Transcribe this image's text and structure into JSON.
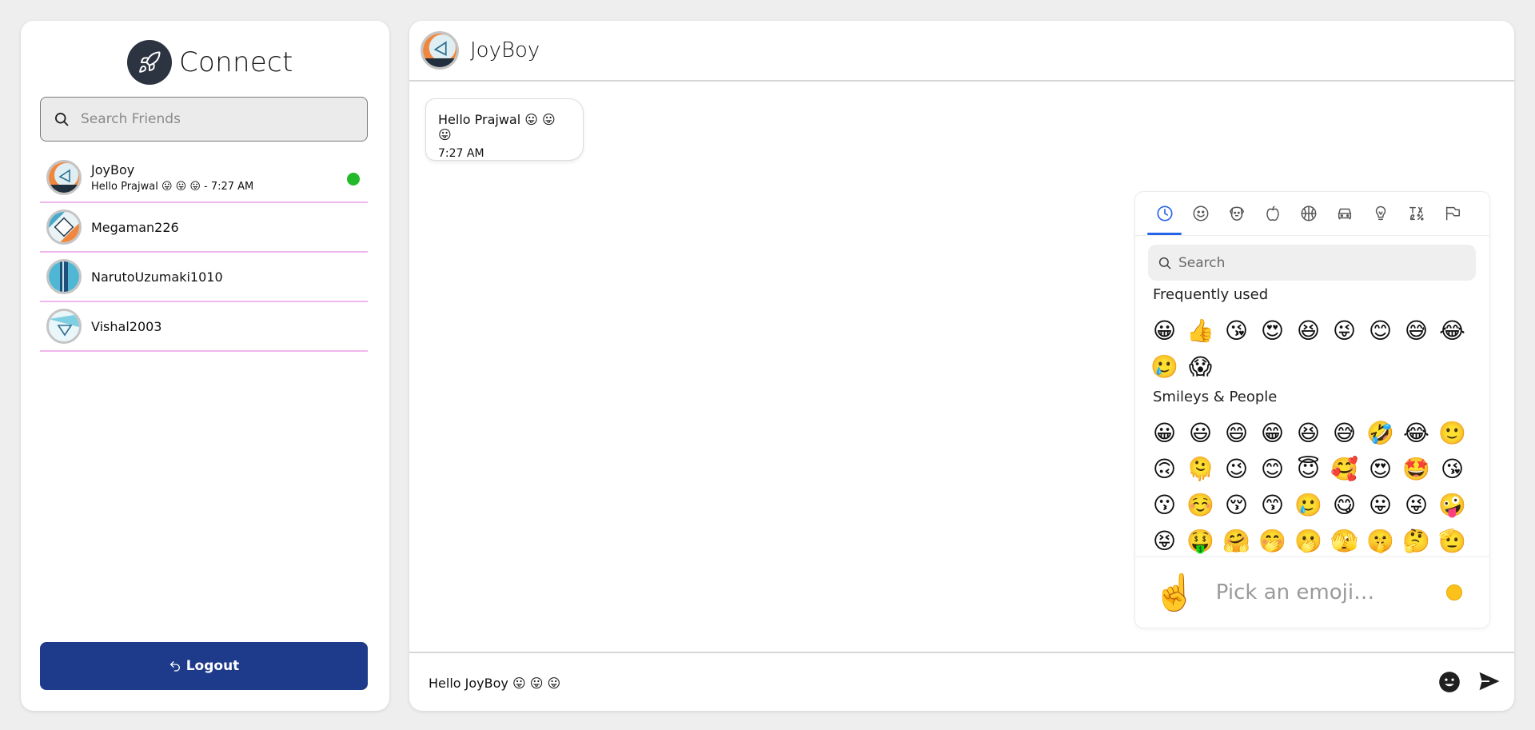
{
  "brand": {
    "title": "Connect"
  },
  "search": {
    "placeholder": "Search Friends"
  },
  "friends": [
    {
      "name": "JoyBoy",
      "last_message": "Hello Prajwal 😛 😛 😛 - 7:27 AM",
      "online": true
    },
    {
      "name": "Megaman226"
    },
    {
      "name": "NarutoUzumaki1010"
    },
    {
      "name": "Vishal2003"
    }
  ],
  "logout": {
    "label": "Logout"
  },
  "chat": {
    "title": "JoyBoy",
    "messages": [
      {
        "text": "Hello Prajwal 😛 😛 😛",
        "time": "7:27 AM"
      }
    ],
    "composer": {
      "value": "Hello JoyBoy 😛 😛 😛"
    }
  },
  "emoji_picker": {
    "tab_icons": [
      "clock-icon",
      "smiley-icon",
      "dog-icon",
      "apple-icon",
      "basketball-icon",
      "car-icon",
      "lightbulb-icon",
      "symbols-icon",
      "flag-icon"
    ],
    "search_placeholder": "Search",
    "frequent": {
      "title": "Frequently used",
      "emojis": [
        "😀",
        "👍",
        "😘",
        "😍",
        "😆",
        "😜",
        "😊",
        "😅",
        "😂",
        "🥲",
        "😱"
      ]
    },
    "smileys": {
      "title": "Smileys & People",
      "emojis": [
        "😀",
        "😃",
        "😄",
        "😁",
        "😆",
        "😅",
        "🤣",
        "😂",
        "🙂",
        "🙃",
        "🫠",
        "😉",
        "😊",
        "😇",
        "🥰",
        "😍",
        "🤩",
        "😘",
        "😗",
        "☺️",
        "😚",
        "😙",
        "🥲",
        "😋",
        "😛",
        "😜",
        "🤪",
        "😝",
        "🤑",
        "🤗",
        "🤭",
        "🫢",
        "🫣",
        "🤫",
        "🤔",
        "🫡"
      ]
    },
    "preview": {
      "emoji": "☝️",
      "text": "Pick an emoji…"
    },
    "colors": {
      "active_tab": "#2563eb",
      "skin_tone": "#fcc21b"
    }
  },
  "colors": {
    "logout_bg": "#1e3a8a",
    "online": "#22b92b",
    "divider": "#f0b7ec"
  }
}
